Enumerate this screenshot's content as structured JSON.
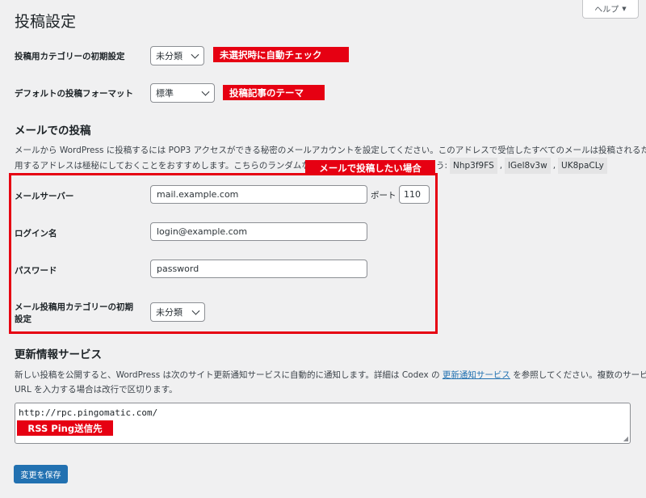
{
  "help_tab": {
    "label": "ヘルプ",
    "icon": "caret-down-icon"
  },
  "page_title": "投稿設定",
  "default_category": {
    "label": "投稿用カテゴリーの初期設定",
    "value": "未分類",
    "callout": "未選択時に自動チェック"
  },
  "default_format": {
    "label": "デフォルトの投稿フォーマット",
    "value": "標準",
    "callout": "投稿記事のテーマ"
  },
  "post_via_email": {
    "title": "メールでの投稿",
    "desc_line1": "メールから WordPress に投稿するには POP3 アクセスができる秘密のメールアカウントを設定してください。このアドレスで受信したすべてのメールは投稿されるため、使",
    "desc_line2": "用するアドレスは極秘にしておくことをおすすめします。こちらのランダムな文字列を参考にしてもいいでしょう:",
    "random_strings": [
      "Nhp3f9FS",
      "lGel8v3w",
      "UK8paCLy"
    ],
    "callout": "メールで投稿したい場合",
    "mail_server_label": "メールサーバー",
    "mail_server_value": "mail.example.com",
    "port_label": "ポート",
    "port_value": "110",
    "login_label": "ログイン名",
    "login_value": "login@example.com",
    "password_label": "パスワード",
    "password_value": "password",
    "category_label_line1": "メール投稿用カテゴリーの初期",
    "category_label_line2": "設定",
    "category_value": "未分類"
  },
  "update_services": {
    "title": "更新情報サービス",
    "desc_line1_a": "新しい投稿を公開すると、WordPress は次のサイト更新通知サービスに自動的に通知します。詳細は Codex の ",
    "desc_link": "更新通知サービス",
    "desc_line1_b": " を参照してください。複数のサービスの",
    "desc_line2": "URL を入力する場合は改行で区切ります。",
    "textarea_value": "http://rpc.pingomatic.com/",
    "callout": "RSS Ping送信先"
  },
  "save_button": "変更を保存",
  "colors": {
    "accent": "#2271b1",
    "callout_red": "#e60012",
    "background": "#f0f0f1"
  }
}
